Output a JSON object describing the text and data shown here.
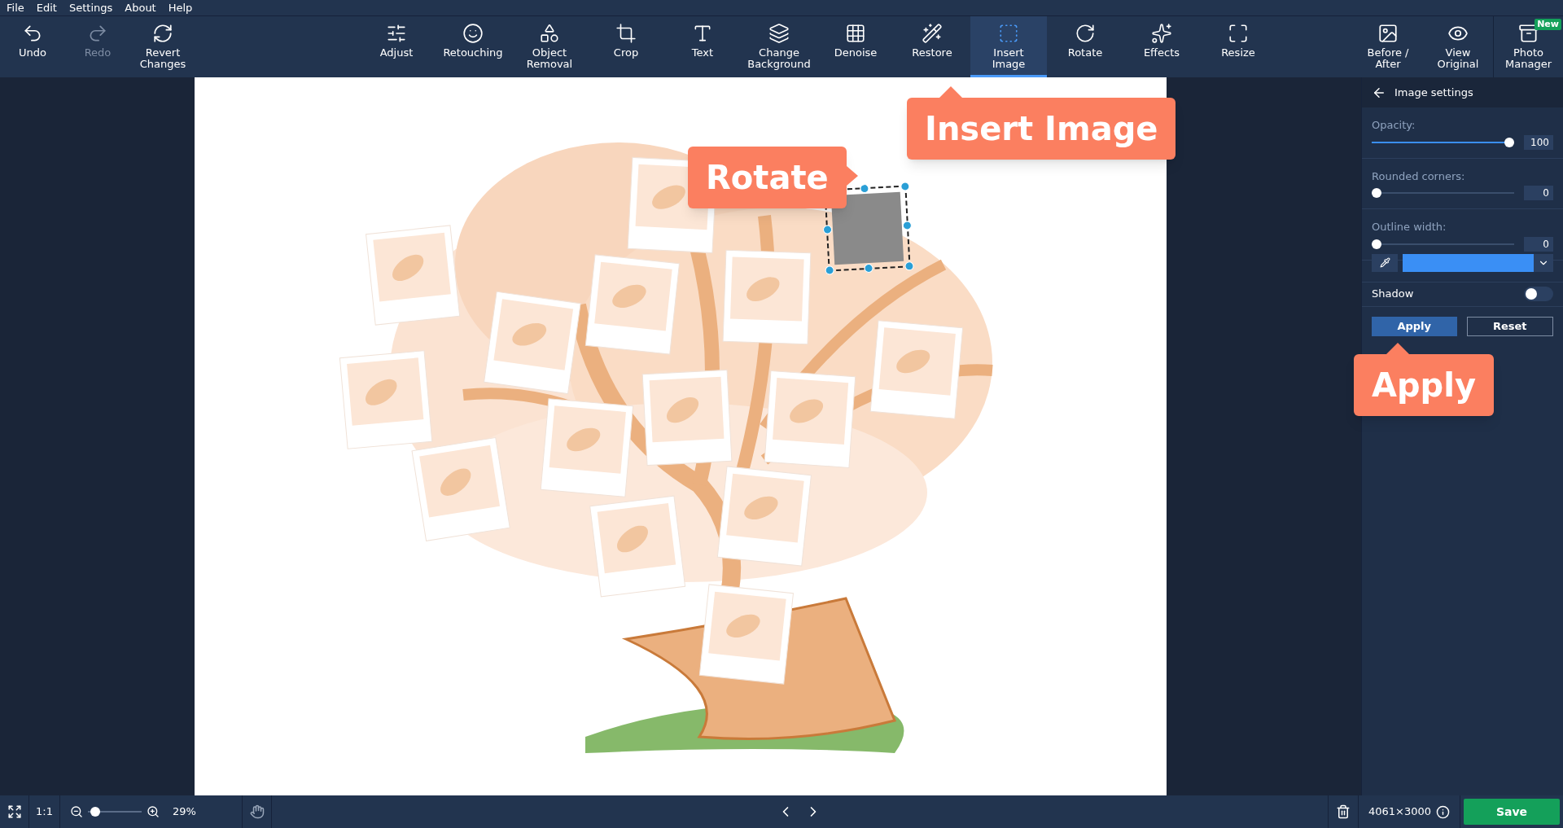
{
  "menu": [
    "File",
    "Edit",
    "Settings",
    "About",
    "Help"
  ],
  "toolbar_left": [
    {
      "label": "Undo",
      "disabled": false
    },
    {
      "label": "Redo",
      "disabled": true
    },
    {
      "label": "Revert Changes",
      "disabled": false
    }
  ],
  "toolbar_center": [
    {
      "label": "Adjust",
      "selected": false
    },
    {
      "label": "Retouching",
      "selected": false
    },
    {
      "label": "Object Removal",
      "selected": false
    },
    {
      "label": "Crop",
      "selected": false
    },
    {
      "label": "Text",
      "selected": false
    },
    {
      "label": "Change Background",
      "selected": false
    },
    {
      "label": "Denoise",
      "selected": false
    },
    {
      "label": "Restore",
      "selected": false
    },
    {
      "label": "Insert Image",
      "selected": true
    },
    {
      "label": "Rotate",
      "selected": false
    },
    {
      "label": "Effects",
      "selected": false
    },
    {
      "label": "Resize",
      "selected": false
    }
  ],
  "toolbar_right": [
    {
      "label": "Before / After"
    },
    {
      "label": "View Original"
    },
    {
      "label": "Photo Manager",
      "badge": "New"
    }
  ],
  "callouts": [
    {
      "text": "Insert Image"
    },
    {
      "text": "Rotate"
    },
    {
      "text": "Apply"
    }
  ],
  "panel": {
    "title": "Image settings",
    "sliders": [
      {
        "label": "Opacity:",
        "level": 1,
        "reading": "100"
      },
      {
        "label": "Rounded corners:",
        "level": 0,
        "reading": "0"
      },
      {
        "label": "Outline width:",
        "level": 0,
        "reading": "0"
      }
    ],
    "shadow": {
      "label": "Shadow",
      "on": false
    },
    "buttons": [
      "Apply",
      "Reset"
    ]
  },
  "status_bar": {
    "ratio": "1:1",
    "zoom": {
      "level": 0.05,
      "reading": "29%"
    },
    "dimensions": "4061×3000",
    "save": "Save"
  }
}
